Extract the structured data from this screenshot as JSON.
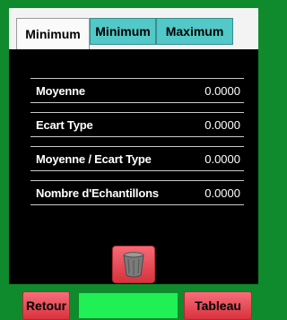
{
  "tabs": [
    {
      "label": "Minimum",
      "active": true
    },
    {
      "label": "Minimum",
      "active": false
    },
    {
      "label": "Maximum",
      "active": false
    }
  ],
  "stats": [
    {
      "label": "Moyenne",
      "value": "0.0000"
    },
    {
      "label": "Ecart Type",
      "value": "0.0000"
    },
    {
      "label": "Moyenne / Ecart Type",
      "value": "0.0000"
    },
    {
      "label": "Nombre d'Echantillons",
      "value": "0.0000"
    }
  ],
  "buttons": {
    "back": "Retour",
    "table": "Tableau",
    "delete_icon": "trash-icon"
  },
  "colors": {
    "frame": "#0f8a2c",
    "tab_inactive": "#52c8c8",
    "button_red": "#e0424d",
    "bar_green": "#20ef55"
  }
}
